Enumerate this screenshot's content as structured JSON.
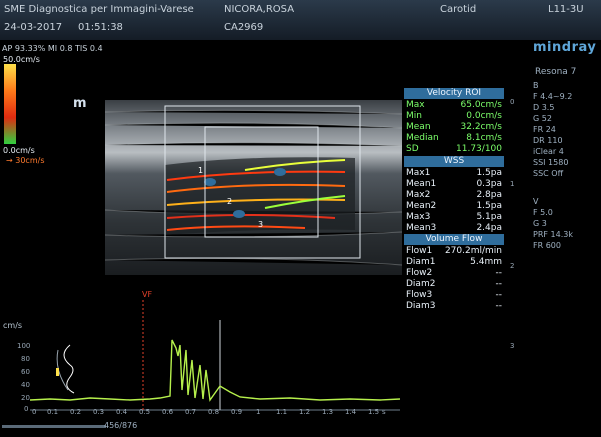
{
  "header": {
    "institution": "SME Diagnostica per Immagini-Varese",
    "date": "24-03-2017",
    "time": "01:51:38",
    "patient_name": "NICORA,ROSA",
    "patient_id": "CA2969",
    "exam": "Carotid",
    "probe": "L11-3U"
  },
  "brand": {
    "logo": "mindray",
    "model": "Resona 7",
    "accent": "#2f6d9c"
  },
  "acquisition": {
    "line": "AP 93.33%  MI 0.8  TIS 0.4"
  },
  "color_scale": {
    "top": "50.0cm/s",
    "bottom": "0.0cm/s",
    "arrow_label": "30cm/s"
  },
  "probe_marker": "m",
  "velocity_roi": {
    "title": "Velocity ROI",
    "rows": [
      {
        "k": "Max",
        "v": "65.0cm/s"
      },
      {
        "k": "Min",
        "v": "0.0cm/s"
      },
      {
        "k": "Mean",
        "v": "32.2cm/s"
      },
      {
        "k": "Median",
        "v": "8.1cm/s"
      },
      {
        "k": "SD",
        "v": "11.73/100"
      }
    ]
  },
  "wss": {
    "title": "WSS",
    "rows": [
      {
        "k": "Max1",
        "v": "1.5pa"
      },
      {
        "k": "Mean1",
        "v": "0.3pa"
      },
      {
        "k": "Max2",
        "v": "2.8pa"
      },
      {
        "k": "Mean2",
        "v": "1.5pa"
      },
      {
        "k": "Max3",
        "v": "5.1pa"
      },
      {
        "k": "Mean3",
        "v": "2.4pa"
      }
    ]
  },
  "volume_flow": {
    "title": "Volume Flow",
    "rows": [
      {
        "k": "Flow1",
        "v": "270.2ml/min"
      },
      {
        "k": "Diam1",
        "v": "5.4mm"
      },
      {
        "k": "Flow2",
        "v": "--"
      },
      {
        "k": "Diam2",
        "v": "--"
      },
      {
        "k": "Flow3",
        "v": "--"
      },
      {
        "k": "Diam3",
        "v": "--"
      }
    ]
  },
  "b_settings": {
    "title": "B",
    "items": [
      "F 4.4~9.2",
      "D 3.5",
      "G 52",
      "FR 24",
      "DR 110",
      "iClear 4",
      "SSI 1580",
      "SSC Off"
    ]
  },
  "v_settings": {
    "title": "V",
    "items": [
      "F 5.0",
      "G 3",
      "PRF 14.3k",
      "FR 600"
    ]
  },
  "depth_ticks": [
    "0",
    "1",
    "2",
    "3"
  ],
  "roi_labels": {
    "one": "1",
    "two": "2",
    "three": "3"
  },
  "trace": {
    "y_unit": "cm/s",
    "y_ticks": [
      "100",
      "80",
      "60",
      "40",
      "20",
      "0"
    ],
    "x_ticks": [
      "0",
      "0.1",
      "0.2",
      "0.3",
      "0.4",
      "0.5",
      "0.6",
      "0.7",
      "0.8",
      "0.9",
      "1",
      "1.1",
      "1.2",
      "1.3",
      "1.4",
      "1.5"
    ],
    "x_unit": "s",
    "marker_label": "VF",
    "frame_counter": "456/876"
  }
}
